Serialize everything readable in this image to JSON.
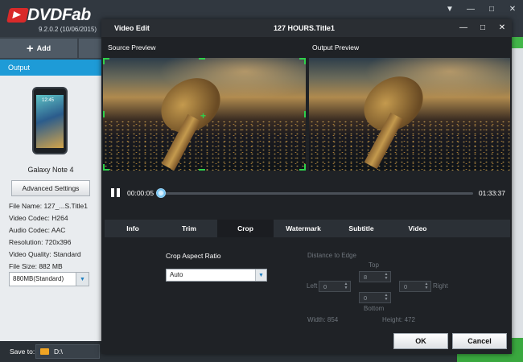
{
  "app": {
    "logo_text": "DVDFab",
    "version": "9.2.0.2 (10/06/2015)",
    "window_controls": [
      "▼",
      "—",
      "□",
      "✕"
    ]
  },
  "toolbar": {
    "add_label": "Add",
    "add_icon": "plus-icon"
  },
  "left_panel": {
    "output_header": "Output",
    "phone_time": "12:45",
    "device_name": "Galaxy Note 4",
    "advanced_settings_label": "Advanced Settings",
    "info": {
      "file_name": "File Name: 127_...S.Title1",
      "video_codec": "Video Codec: H264",
      "audio_codec": "Audio Codec: AAC",
      "resolution": "Resolution: 720x396",
      "video_quality": "Video Quality: Standard",
      "file_size": "File Size: 882 MB"
    },
    "size_select_value": "880MB(Standard)"
  },
  "save_bar": {
    "label": "Save to:",
    "path": "D:\\"
  },
  "dialog": {
    "title": "Video Edit",
    "subtitle": "127  HOURS.Title1",
    "controls": [
      "—",
      "□",
      "✕"
    ],
    "source_preview_label": "Source Preview",
    "output_preview_label": "Output Preview",
    "time_current": "00:00:05",
    "time_total": "01:33:37",
    "playback_progress": 0.0009,
    "tabs": [
      {
        "label": "Info",
        "active": false
      },
      {
        "label": "Trim",
        "active": false
      },
      {
        "label": "Crop",
        "active": true
      },
      {
        "label": "Watermark",
        "active": false
      },
      {
        "label": "Subtitle",
        "active": false
      },
      {
        "label": "Video",
        "active": false
      }
    ],
    "crop": {
      "aspect_ratio_label": "Crop Aspect Ratio",
      "aspect_ratio_value": "Auto",
      "distance_label": "Distance to Edge",
      "top_label": "Top",
      "top_value": "8",
      "left_label": "Left",
      "left_value": "0",
      "right_label": "Right",
      "right_value": "0",
      "bottom_label": "Bottom",
      "bottom_value": "0",
      "width_text": "Width: 854",
      "height_text": "Height: 472"
    },
    "ok_label": "OK",
    "cancel_label": "Cancel"
  },
  "colors": {
    "accent_blue": "#1e9bd7",
    "crop_green": "#2fd14b",
    "start_green": "#3aa83f",
    "dialog_bg": "#1f2226"
  }
}
